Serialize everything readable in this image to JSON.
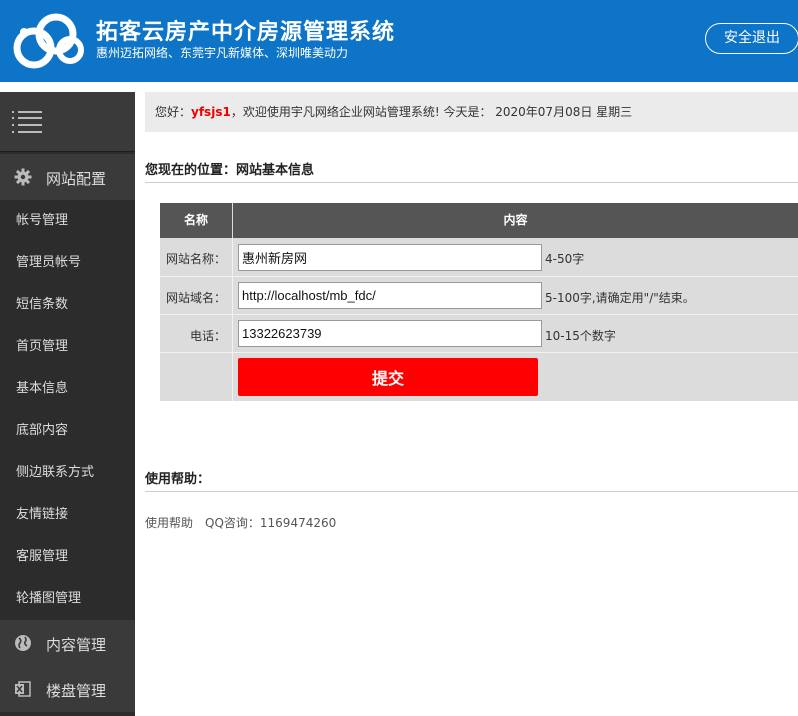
{
  "header": {
    "title": "拓客云房产中介房源管理系统",
    "subtitle": "惠州迈拓网络、东莞宇凡新媒体、深圳唯美动力",
    "logout_label": "安全退出",
    "logo_icon": "cloud-logo-icon"
  },
  "sidebar": {
    "menu_icon": "hamburger-menu-icon",
    "sections": [
      {
        "label": "网站配置",
        "icon": "gear-icon"
      },
      {
        "label": "内容管理",
        "icon": "globe-icon"
      },
      {
        "label": "楼盘管理",
        "icon": "excel-icon"
      }
    ],
    "items": [
      "帐号管理",
      "管理员帐号",
      "短信条数",
      "首页管理",
      "基本信息",
      "底部内容",
      "侧边联系方式",
      "友情链接",
      "客服管理",
      "轮播图管理"
    ]
  },
  "welcome": {
    "prefix": "您好：",
    "username": "yfsjs1",
    "message": "，欢迎使用宇凡网络企业网站管理系统! 今天是： 2020年07月08日 星期三"
  },
  "breadcrumb": "您现在的位置：网站基本信息",
  "form": {
    "col_name": "名称",
    "col_content": "内容",
    "rows": [
      {
        "label": "网站名称：",
        "value": "惠州新房网",
        "hint": "4-50字"
      },
      {
        "label": "网站域名：",
        "value": "http://localhost/mb_fdc/",
        "hint": "5-100字,请确定用\"/\"结束。"
      },
      {
        "label": "电话：",
        "value": "13322623739",
        "hint": "10-15个数字"
      }
    ],
    "submit_label": "提交"
  },
  "help": {
    "title": "使用帮助：",
    "link": "使用帮助",
    "qq": "QQ咨询：1169474260"
  },
  "colors": {
    "header_bg": "#0e74c7",
    "sidebar_bg": "#2c2c2c",
    "submit_bg": "#ff0000",
    "username": "#ee0000"
  }
}
